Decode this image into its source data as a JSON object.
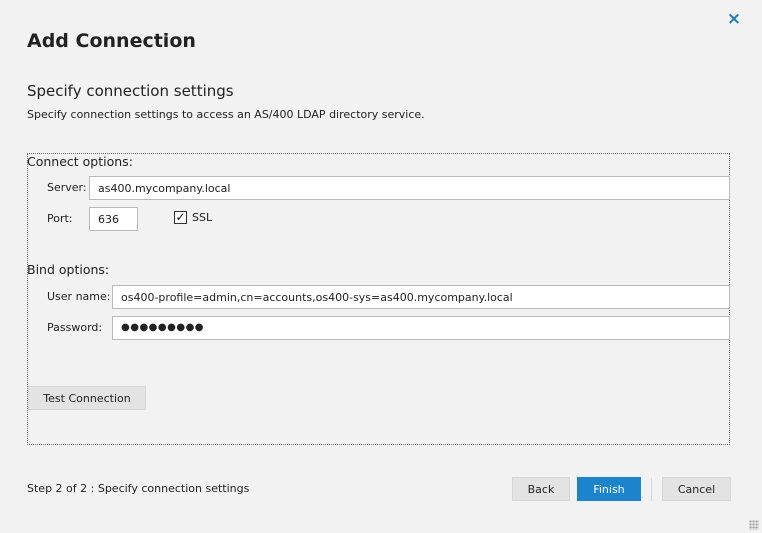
{
  "dialog": {
    "title": "Add Connection",
    "close_icon": "×"
  },
  "section": {
    "title": "Specify connection settings",
    "description": "Specify connection settings to access an AS/400 LDAP directory service."
  },
  "connect_options": {
    "label": "Connect options:",
    "server_label": "Server:",
    "server_value": "as400.mycompany.local",
    "port_label": "Port:",
    "port_value": "636",
    "ssl_label": "SSL",
    "ssl_checked": true,
    "ssl_check_glyph": "✓"
  },
  "bind_options": {
    "label": "Bind options:",
    "username_label": "User name:",
    "username_value": "os400-profile=admin,cn=accounts,os400-sys=as400.mycompany.local",
    "password_label": "Password:",
    "password_value": "●●●●●●●●●"
  },
  "test_button": "Test Connection",
  "footer": {
    "step_text": "Step 2 of 2 : Specify connection settings",
    "back_label": "Back",
    "finish_label": "Finish",
    "cancel_label": "Cancel"
  },
  "colors": {
    "accent": "#1b84cc",
    "background": "#f2f2f2",
    "button_gray": "#e3e3e3"
  }
}
